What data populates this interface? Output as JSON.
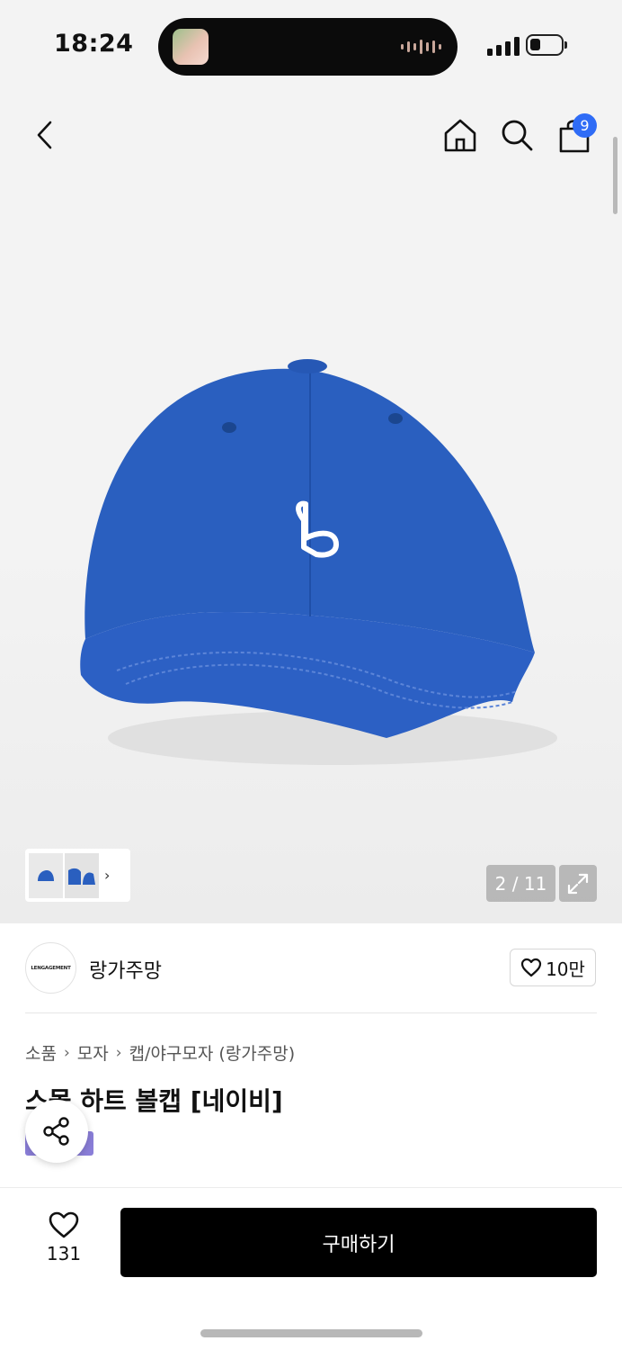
{
  "status": {
    "time": "18:24",
    "battery_level": 0.3
  },
  "header": {
    "cart_count": "9"
  },
  "gallery": {
    "pager": "2 / 11",
    "thumb_arrow": "›"
  },
  "brand": {
    "name": "랑가주망",
    "logo_text": "LENGAGEMENT",
    "likes": "10만"
  },
  "breadcrumb": [
    "소품",
    "모자",
    "캡/야구모자 (랑가주망)"
  ],
  "product": {
    "title": "스몰 하트 볼캡 [네이비]",
    "cap_color": "#2a5fbf"
  },
  "bottom": {
    "wish_count": "131",
    "buy_label": "구매하기"
  }
}
